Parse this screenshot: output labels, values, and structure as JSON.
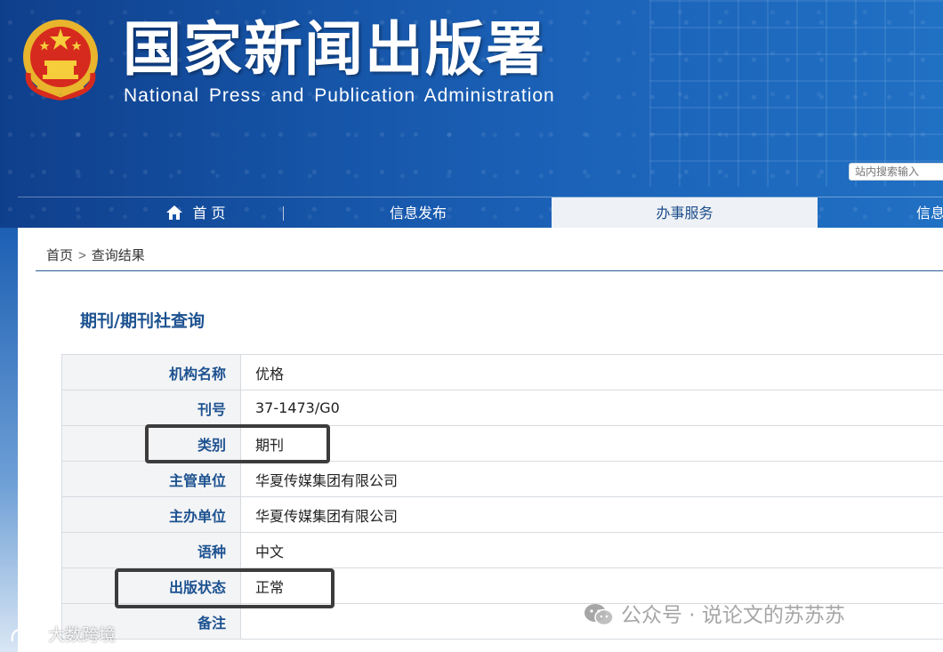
{
  "header": {
    "title_cn": "国家新闻出版署",
    "title_en": "National  Press and Publication Administration",
    "search_placeholder": "站内搜索输入"
  },
  "nav": {
    "items": [
      {
        "label": "首 页",
        "icon": "home-icon"
      },
      {
        "label": "信息发布"
      },
      {
        "label": "办事服务",
        "active": true
      },
      {
        "label": "信息"
      }
    ]
  },
  "breadcrumb": {
    "home": "首页",
    "separator": ">",
    "current": "查询结果"
  },
  "page_title": "期刊/期刊社查询",
  "details": [
    {
      "label": "机构名称",
      "value": "优格"
    },
    {
      "label": "刊号",
      "value": "37-1473/G0"
    },
    {
      "label": "类别",
      "value": "期刊",
      "highlighted": true
    },
    {
      "label": "主管单位",
      "value": "华夏传媒集团有限公司"
    },
    {
      "label": "主办单位",
      "value": "华夏传媒集团有限公司"
    },
    {
      "label": "语种",
      "value": "中文"
    },
    {
      "label": "出版状态",
      "value": "正常",
      "highlighted": true
    },
    {
      "label": "备注",
      "value": ""
    }
  ],
  "watermarks": {
    "wechat": "公众号 · 说论文的苏苏苏",
    "brand": "大数跨境"
  },
  "colors": {
    "header_blue": "#1655a8",
    "label_blue": "#1d5290",
    "active_tab_bg": "#eef1f5",
    "highlight_border": "#3c3c3c"
  }
}
